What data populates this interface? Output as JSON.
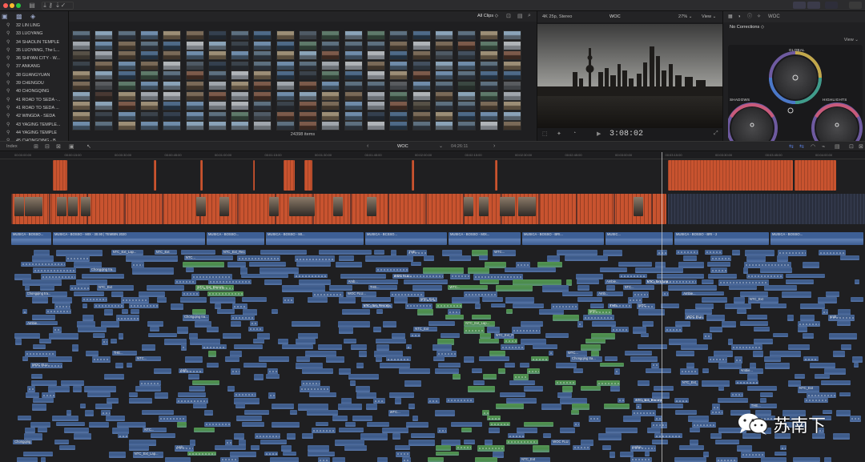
{
  "window": {
    "toolbar_icons": [
      "library-icon",
      "photos-icon",
      "import-icon",
      "key-icon",
      "check-icon"
    ]
  },
  "library": {
    "items": [
      {
        "label": "32 LIN LING"
      },
      {
        "label": "33 LUOYANG"
      },
      {
        "label": "34 SHAOLIN TEMPLE"
      },
      {
        "label": "35 LUOYANG, The L..."
      },
      {
        "label": "36 SHIYAN CITY - W..."
      },
      {
        "label": "37 ANKANG"
      },
      {
        "label": "38 GUANGYUAN"
      },
      {
        "label": "39 CHENGDU"
      },
      {
        "label": "40 CHONGQING"
      },
      {
        "label": "41 ROAD TO SEDA -..."
      },
      {
        "label": "41 ROAD TO SEDA ..."
      },
      {
        "label": "42 WINGDA - SEDA"
      },
      {
        "label": "43 YAGING TEMPLE..."
      },
      {
        "label": "44 YAGING TEMPLE"
      },
      {
        "label": "45 CHONGQING - B..."
      }
    ]
  },
  "browser": {
    "clip_filter": "All Clips ◇",
    "item_count": "24398 items"
  },
  "viewer": {
    "format": "4K 25p, Stereo",
    "project": "WOC",
    "zoom": "27% ⌄",
    "view": "View ⌄",
    "timecode": "3:08:02"
  },
  "inspector": {
    "title": "WOC",
    "corrections": "No Corrections ◇",
    "view": "View ⌄",
    "wheels": {
      "global": "GLOBAL",
      "shadows": "SHADOWS",
      "highlights": "HIGHLIGHTS"
    }
  },
  "timeline_bar": {
    "index": "Index",
    "project": "WOC",
    "duration": "04:26:11"
  },
  "ruler": {
    "ticks": [
      "00:00:00:00",
      "00:00:15:00",
      "00:00:30:00",
      "00:00:45:00",
      "00:01:00:00",
      "00:01:15:00",
      "00:01:30:00",
      "00:01:45:00",
      "00:02:00:00",
      "00:02:15:00",
      "00:02:30:00",
      "00:02:45:00",
      "00:03:00:00",
      "00:03:15:00",
      "00:03:30:00",
      "00:03:45:00",
      "00:04:00:00",
      "00:04:15:00"
    ]
  },
  "timeline": {
    "audio_labels": [
      "MUSICA - BOSSO...",
      "MUSICA - BOSSO - MIX - 30.90 | TEMBIN 2020",
      "MUSICA - BOSSO...",
      "MUSICA - BOSSO - MI...",
      "MUSICA - BCSSO...",
      "MUSICA - BOSSO - MIX...",
      "MUSICA - BOSSO - BRI...",
      "MUSIC...",
      "MUSICA - BOSSO - BRI - 2"
    ],
    "clip_labels": [
      "NTC_Ext_Lap...",
      "NTC_Ext",
      "NTC_Ext_Recorp...",
      "THE...",
      "WTC...",
      "NTC...",
      "Chongqing tra...",
      "WOC FLU...",
      "Amb...",
      "Ambie..."
    ]
  },
  "watermark": {
    "text": "苏南下"
  },
  "colors": {
    "orange_clip": "#c8532f",
    "blue_clip": "#3c5a8a",
    "green_clip": "#4a8c4a",
    "background": "#1f1f21"
  }
}
